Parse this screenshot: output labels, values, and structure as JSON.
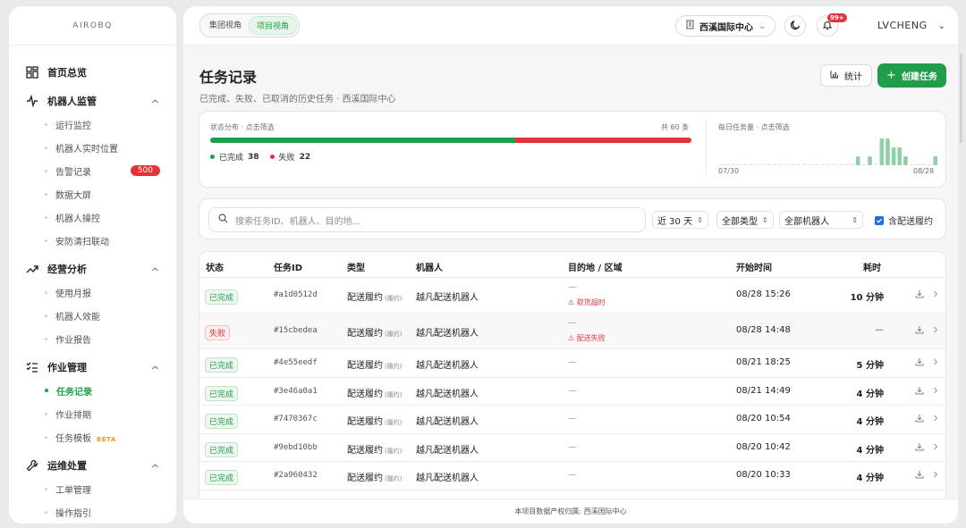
{
  "brand": "AIROBQ",
  "sidebar": {
    "groups": [
      {
        "label": "首页总览",
        "icon": "dashboard-icon",
        "items": []
      },
      {
        "label": "机器人监管",
        "icon": "pulse-icon",
        "items": [
          {
            "label": "运行监控"
          },
          {
            "label": "机器人实时位置"
          },
          {
            "label": "告警记录",
            "badge": "500"
          },
          {
            "label": "数据大屏"
          },
          {
            "label": "机器人操控"
          },
          {
            "label": "安防清扫联动"
          }
        ]
      },
      {
        "label": "经营分析",
        "icon": "trend-icon",
        "items": [
          {
            "label": "使用月报"
          },
          {
            "label": "机器人效能"
          },
          {
            "label": "作业报告"
          }
        ]
      },
      {
        "label": "作业管理",
        "icon": "checklist-icon",
        "items": [
          {
            "label": "任务记录",
            "active": true
          },
          {
            "label": "作业排期"
          },
          {
            "label": "任务模板",
            "tag": "BETA"
          }
        ]
      },
      {
        "label": "运维处置",
        "icon": "wrench-icon",
        "items": [
          {
            "label": "工单管理"
          },
          {
            "label": "操作指引"
          }
        ]
      }
    ]
  },
  "topbar": {
    "view_group": "集团视角",
    "view_project": "项目视角",
    "project": "西溪国际中心",
    "bell_badge": "99+",
    "user": "LVCHENG"
  },
  "page": {
    "title": "任务记录",
    "subtitle": "已完成、失败、已取消的历史任务 · 西溪国际中心",
    "stat_button": "统计",
    "create_button": "创建任务"
  },
  "stats": {
    "label": "状态分布 · 点击筛选",
    "total": "共 60 条",
    "done_label": "已完成",
    "done": 38,
    "fail_label": "失败",
    "fail": 22,
    "daily_label": "每日任务量 · 点击筛选",
    "start": "07/30",
    "end": "08/28"
  },
  "chart_data": {
    "type": "bar",
    "title": "每日任务量 · 点击筛选",
    "x_start": "07/30",
    "x_end": "08/28",
    "values": [
      0,
      0,
      0,
      0,
      0,
      0,
      0,
      0,
      0,
      0,
      0,
      0,
      0,
      0,
      0,
      0,
      0,
      0,
      0,
      0,
      0,
      0,
      0,
      1,
      0,
      1,
      0,
      3,
      3,
      2,
      2,
      1,
      0,
      0,
      0,
      0,
      1
    ]
  },
  "filters": {
    "search_placeholder": "搜索任务ID、机器人、目的地...",
    "range": "近 30 天",
    "type": "全部类型",
    "robot": "全部机器人",
    "include": "含配送履约"
  },
  "table": {
    "headers": [
      "状态",
      "任务ID",
      "类型",
      "机器人",
      "目的地 / 区域",
      "开始时间",
      "耗时"
    ],
    "rows": [
      {
        "status": "已完成",
        "ok": true,
        "id": "#a1d0512d",
        "type": "配送履约",
        "tag": "(履约)",
        "robot": "越凡配送机器人",
        "dest": "—",
        "err": "取货超时",
        "start": "08/28 15:26",
        "dur": "10 分钟"
      },
      {
        "status": "失败",
        "ok": false,
        "id": "#15cbedea",
        "type": "配送履约",
        "tag": "(履约)",
        "robot": "越凡配送机器人",
        "dest": "—",
        "err": "配送失败",
        "start": "08/28 14:48",
        "dur": "—"
      },
      {
        "status": "已完成",
        "ok": true,
        "id": "#4e55eedf",
        "type": "配送履约",
        "tag": "(履约)",
        "robot": "越凡配送机器人",
        "dest": "—",
        "err": "",
        "start": "08/21 18:25",
        "dur": "5 分钟"
      },
      {
        "status": "已完成",
        "ok": true,
        "id": "#3e46a0a1",
        "type": "配送履约",
        "tag": "(履约)",
        "robot": "越凡配送机器人",
        "dest": "—",
        "err": "",
        "start": "08/21 14:49",
        "dur": "4 分钟"
      },
      {
        "status": "已完成",
        "ok": true,
        "id": "#7470367c",
        "type": "配送履约",
        "tag": "(履约)",
        "robot": "越凡配送机器人",
        "dest": "—",
        "err": "",
        "start": "08/20 10:54",
        "dur": "4 分钟"
      },
      {
        "status": "已完成",
        "ok": true,
        "id": "#9ebd10bb",
        "type": "配送履约",
        "tag": "(履约)",
        "robot": "越凡配送机器人",
        "dest": "—",
        "err": "",
        "start": "08/20 10:42",
        "dur": "4 分钟"
      },
      {
        "status": "已完成",
        "ok": true,
        "id": "#2a960432",
        "type": "配送履约",
        "tag": "(履约)",
        "robot": "越凡配送机器人",
        "dest": "—",
        "err": "",
        "start": "08/20 10:33",
        "dur": "4 分钟"
      }
    ]
  },
  "footer": "本项目数据产权归属: 西溪国际中心"
}
